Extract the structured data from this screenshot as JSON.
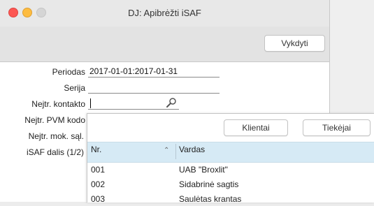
{
  "window": {
    "title": "DJ: Apibrėžti iSAF",
    "execute_label": "Vykdyti"
  },
  "form": {
    "fields": [
      {
        "label": "Periodas",
        "value": "2017-01-01:2017-01-31"
      },
      {
        "label": "Serija",
        "value": ""
      },
      {
        "label": "Nejtr. kontakto",
        "value": ""
      },
      {
        "label": "Nejtr. PVM kodo",
        "value": ""
      },
      {
        "label": "Nejtr. mok. sąl.",
        "value": ""
      },
      {
        "label": "iSAF dalis (1/2)",
        "value": ""
      }
    ]
  },
  "popup": {
    "buttons": {
      "customers": "Klientai",
      "suppliers": "Tiekėjai"
    },
    "columns": {
      "nr": "Nr.",
      "name": "Vardas"
    },
    "rows": [
      {
        "nr": "001",
        "name": "UAB \"Broxlit\""
      },
      {
        "nr": "002",
        "name": "Sidabrinė sagtis"
      },
      {
        "nr": "003",
        "name": "Saulėtas krantas"
      }
    ]
  }
}
